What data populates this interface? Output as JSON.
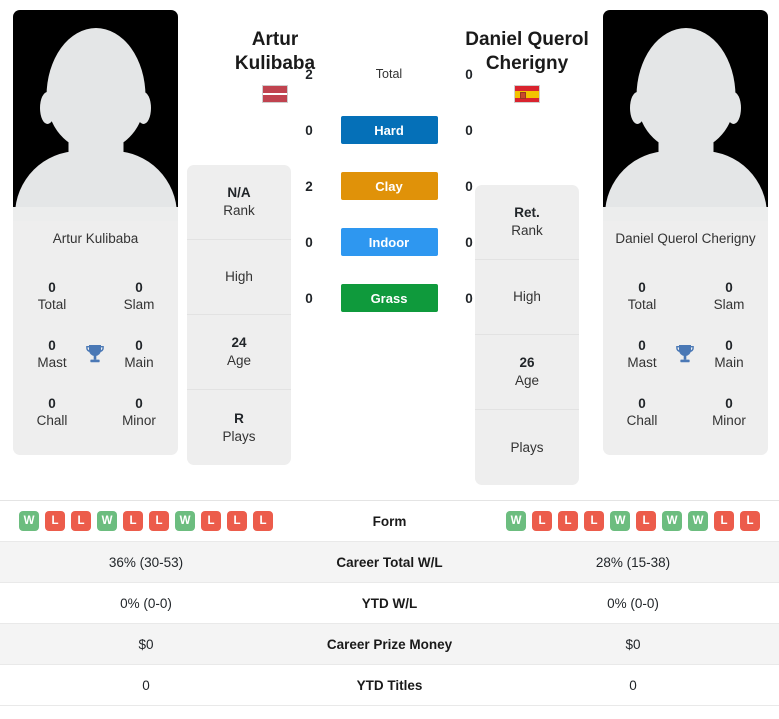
{
  "players": {
    "left": {
      "first_name": "Artur",
      "last_name": "Kulibaba",
      "full_name": "Artur Kulibaba",
      "country": "Latvia",
      "flag_icon": "flag-latvia-icon",
      "avatar_icon": "player-silhouette-icon",
      "titles": {
        "total_value": "0",
        "total_label": "Total",
        "slam_value": "0",
        "slam_label": "Slam",
        "mast_value": "0",
        "mast_label": "Mast",
        "main_value": "0",
        "main_label": "Main",
        "chall_value": "0",
        "chall_label": "Chall",
        "minor_value": "0",
        "minor_label": "Minor",
        "trophy_icon": "trophy-icon"
      },
      "info": [
        {
          "value": "N/A",
          "label": "Rank"
        },
        {
          "value": "",
          "label": "High"
        },
        {
          "value": "24",
          "label": "Age"
        },
        {
          "value": "R",
          "label": "Plays"
        }
      ],
      "form": [
        "W",
        "L",
        "L",
        "W",
        "L",
        "L",
        "W",
        "L",
        "L",
        "L"
      ],
      "career_total_wl": "36% (30-53)",
      "ytd_wl": "0% (0-0)",
      "career_prize_money": "$0",
      "ytd_titles": "0"
    },
    "right": {
      "first_name": "Daniel Querol",
      "last_name": "Cherigny",
      "full_name": "Daniel Querol Cherigny",
      "country": "Spain",
      "flag_icon": "flag-spain-icon",
      "avatar_icon": "player-silhouette-icon",
      "titles": {
        "total_value": "0",
        "total_label": "Total",
        "slam_value": "0",
        "slam_label": "Slam",
        "mast_value": "0",
        "mast_label": "Mast",
        "main_value": "0",
        "main_label": "Main",
        "chall_value": "0",
        "chall_label": "Chall",
        "minor_value": "0",
        "minor_label": "Minor",
        "trophy_icon": "trophy-icon"
      },
      "info": [
        {
          "value": "Ret.",
          "label": "Rank"
        },
        {
          "value": "",
          "label": "High"
        },
        {
          "value": "26",
          "label": "Age"
        },
        {
          "value": "",
          "label": "Plays"
        }
      ],
      "form": [
        "W",
        "L",
        "L",
        "L",
        "W",
        "L",
        "W",
        "W",
        "L",
        "L"
      ],
      "career_total_wl": "28% (15-38)",
      "ytd_wl": "0% (0-0)",
      "career_prize_money": "$0",
      "ytd_titles": "0"
    }
  },
  "head_to_head": [
    {
      "label": "Total",
      "left": "2",
      "right": "0",
      "color": "",
      "style": "plain"
    },
    {
      "label": "Hard",
      "left": "0",
      "right": "0",
      "color": "#0570b8",
      "style": "pill"
    },
    {
      "label": "Clay",
      "left": "2",
      "right": "0",
      "color": "#e09209",
      "style": "pill"
    },
    {
      "label": "Indoor",
      "left": "0",
      "right": "0",
      "color": "#2e97f0",
      "style": "pill"
    },
    {
      "label": "Grass",
      "left": "0",
      "right": "0",
      "color": "#0f9a3c",
      "style": "pill"
    }
  ],
  "stats_rows": [
    {
      "label": "Form",
      "type": "form"
    },
    {
      "label": "Career Total W/L",
      "type": "text",
      "key": "career_total_wl"
    },
    {
      "label": "YTD W/L",
      "type": "text",
      "key": "ytd_wl"
    },
    {
      "label": "Career Prize Money",
      "type": "text",
      "key": "career_prize_money"
    },
    {
      "label": "YTD Titles",
      "type": "text",
      "key": "ytd_titles"
    }
  ],
  "colors": {
    "win_badge": "#6cbd7f",
    "loss_badge": "#ec5c4b",
    "card_background": "#eeeeee",
    "trophy": "#4a78b5"
  }
}
